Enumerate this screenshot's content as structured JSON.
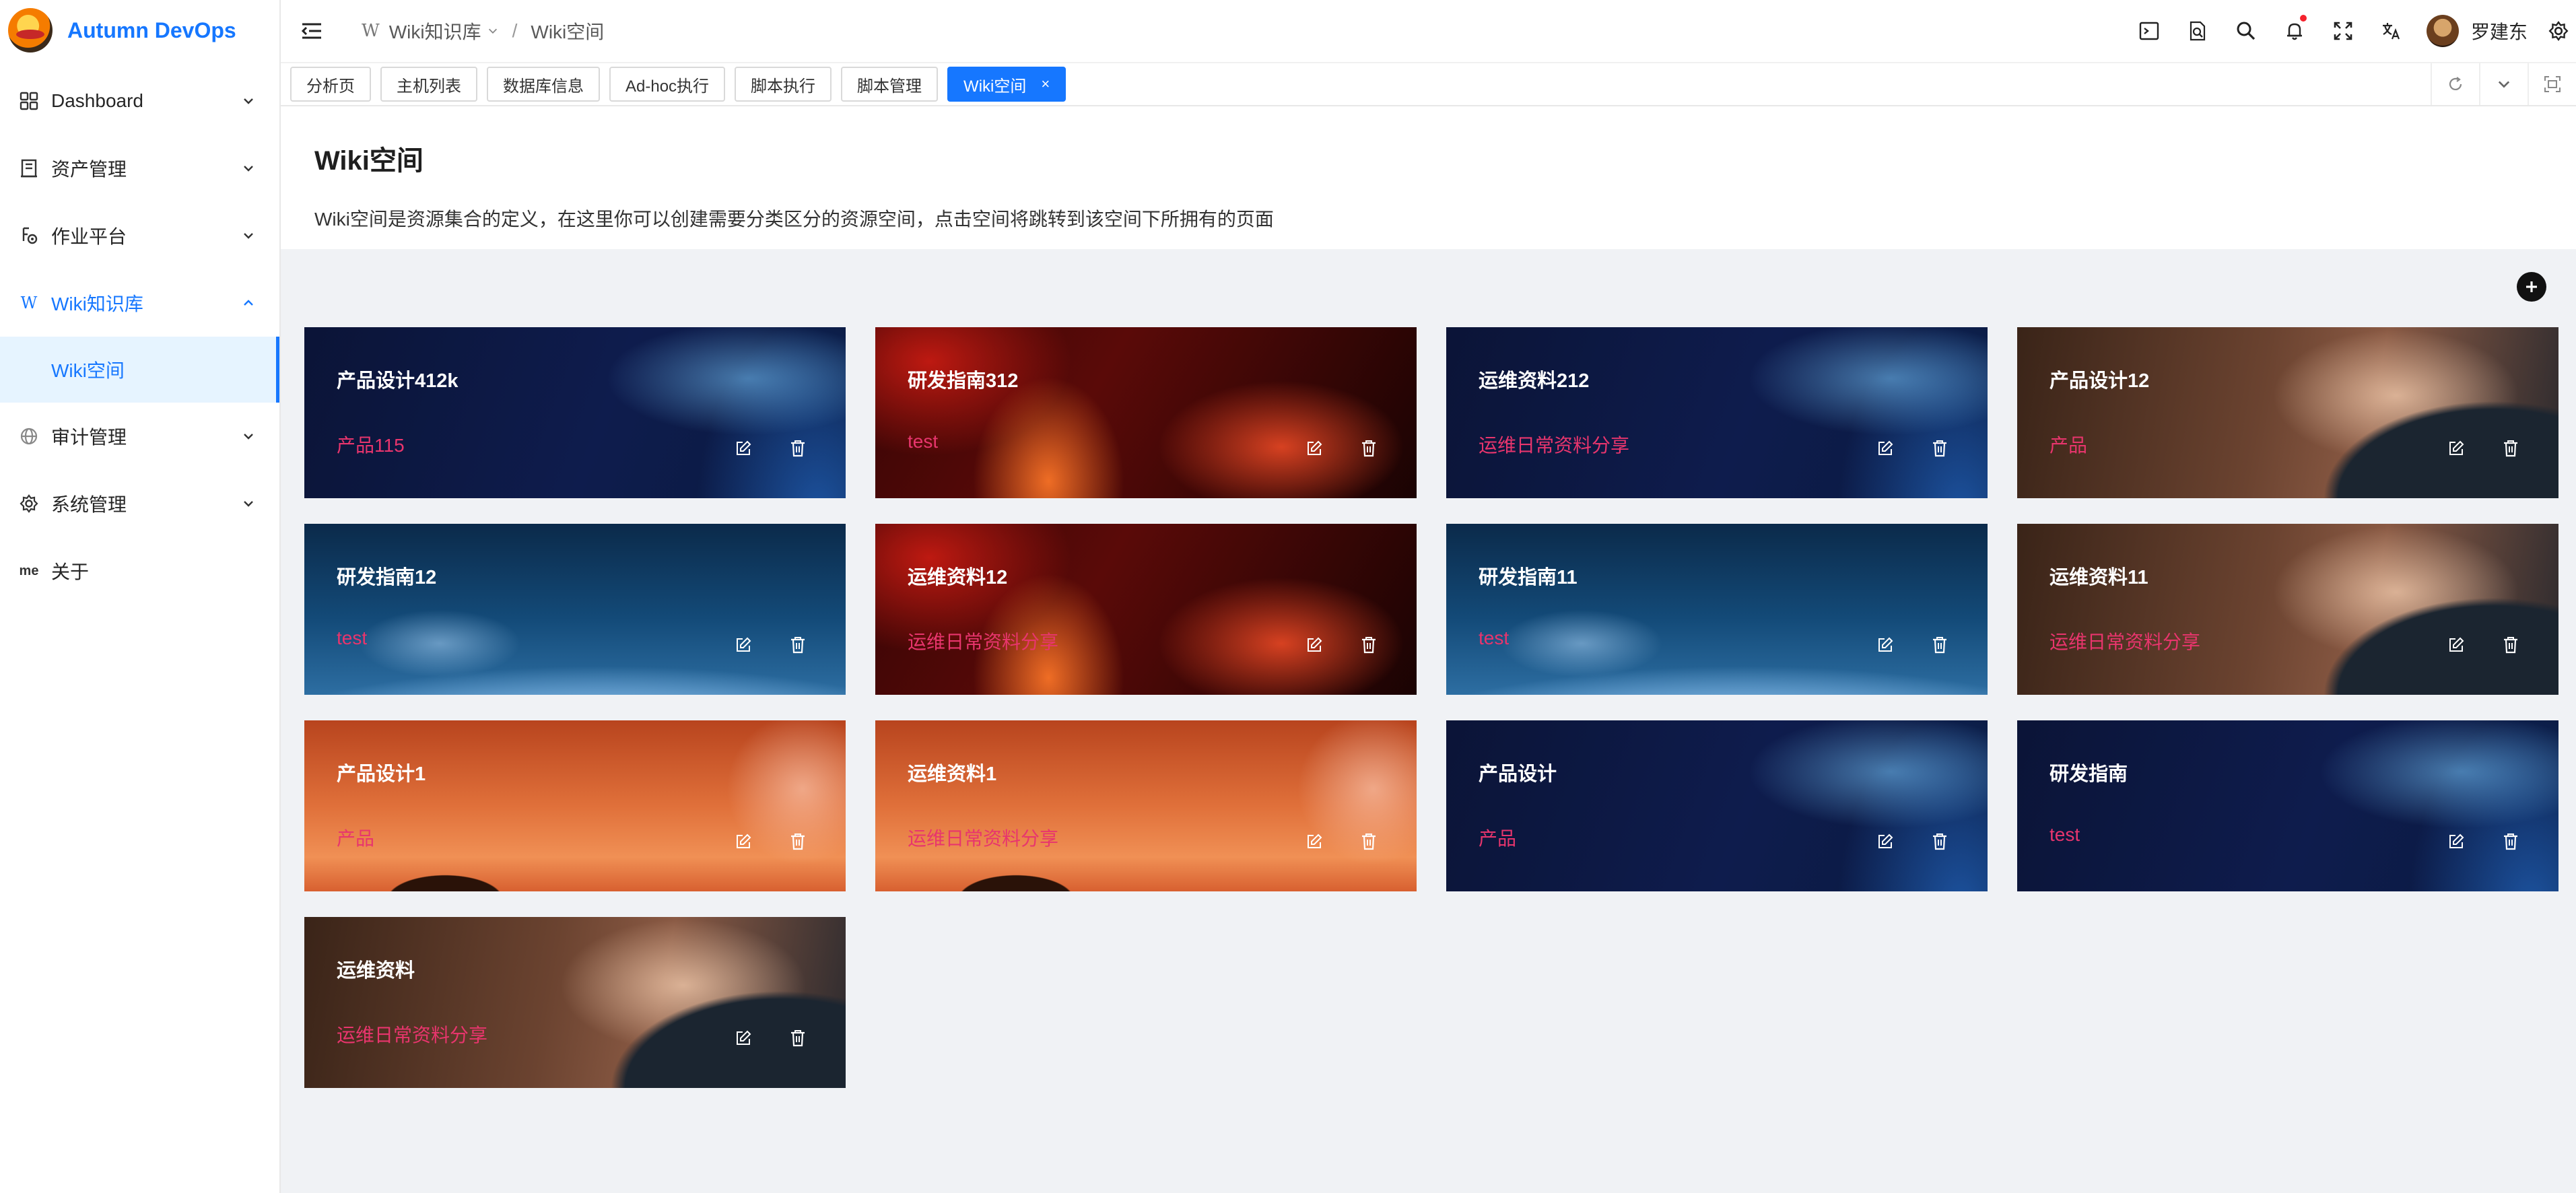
{
  "app": {
    "name": "Autumn DevOps"
  },
  "sidebar": {
    "items": [
      {
        "label": "Dashboard"
      },
      {
        "label": "资产管理"
      },
      {
        "label": "作业平台"
      },
      {
        "label": "Wiki知识库",
        "icon_text": "W"
      },
      {
        "label": "审计管理"
      },
      {
        "label": "系统管理"
      },
      {
        "label": "关于",
        "icon_text": "me"
      }
    ],
    "sub_active": "Wiki空间"
  },
  "header": {
    "breadcrumb_root": "Wiki知识库",
    "breadcrumb_root_icon": "W",
    "breadcrumb_sep": "/",
    "breadcrumb_current": "Wiki空间",
    "username": "罗建东"
  },
  "tabs": [
    {
      "label": "分析页"
    },
    {
      "label": "主机列表"
    },
    {
      "label": "数据库信息"
    },
    {
      "label": "Ad-hoc执行"
    },
    {
      "label": "脚本执行"
    },
    {
      "label": "脚本管理"
    },
    {
      "label": "Wiki空间",
      "active": true,
      "close": "×"
    }
  ],
  "page": {
    "title": "Wiki空间",
    "description": "Wiki空间是资源集合的定义，在这里你可以创建需要分类区分的资源空间，点击空间将跳转到该空间下所拥有的页面"
  },
  "spaces": [
    {
      "title": "产品设计412k",
      "desc": "产品115",
      "bg": "blue"
    },
    {
      "title": "研发指南312",
      "desc": "test",
      "bg": "red"
    },
    {
      "title": "运维资料212",
      "desc": "运维日常资料分享",
      "bg": "blue"
    },
    {
      "title": "产品设计12",
      "desc": "产品",
      "bg": "hair"
    },
    {
      "title": "研发指南12",
      "desc": "test",
      "bg": "planet"
    },
    {
      "title": "运维资料12",
      "desc": "运维日常资料分享",
      "bg": "red"
    },
    {
      "title": "研发指南11",
      "desc": "test",
      "bg": "planet"
    },
    {
      "title": "运维资料11",
      "desc": "运维日常资料分享",
      "bg": "hair"
    },
    {
      "title": "产品设计1",
      "desc": "产品",
      "bg": "sunset"
    },
    {
      "title": "运维资料1",
      "desc": "运维日常资料分享",
      "bg": "sunset"
    },
    {
      "title": "产品设计",
      "desc": "产品",
      "bg": "blue"
    },
    {
      "title": "研发指南",
      "desc": "test",
      "bg": "blue"
    },
    {
      "title": "运维资料",
      "desc": "运维日常资料分享",
      "bg": "hair"
    }
  ],
  "colors": {
    "accent": "#1677ff",
    "desc_pink": "#e8356d"
  }
}
